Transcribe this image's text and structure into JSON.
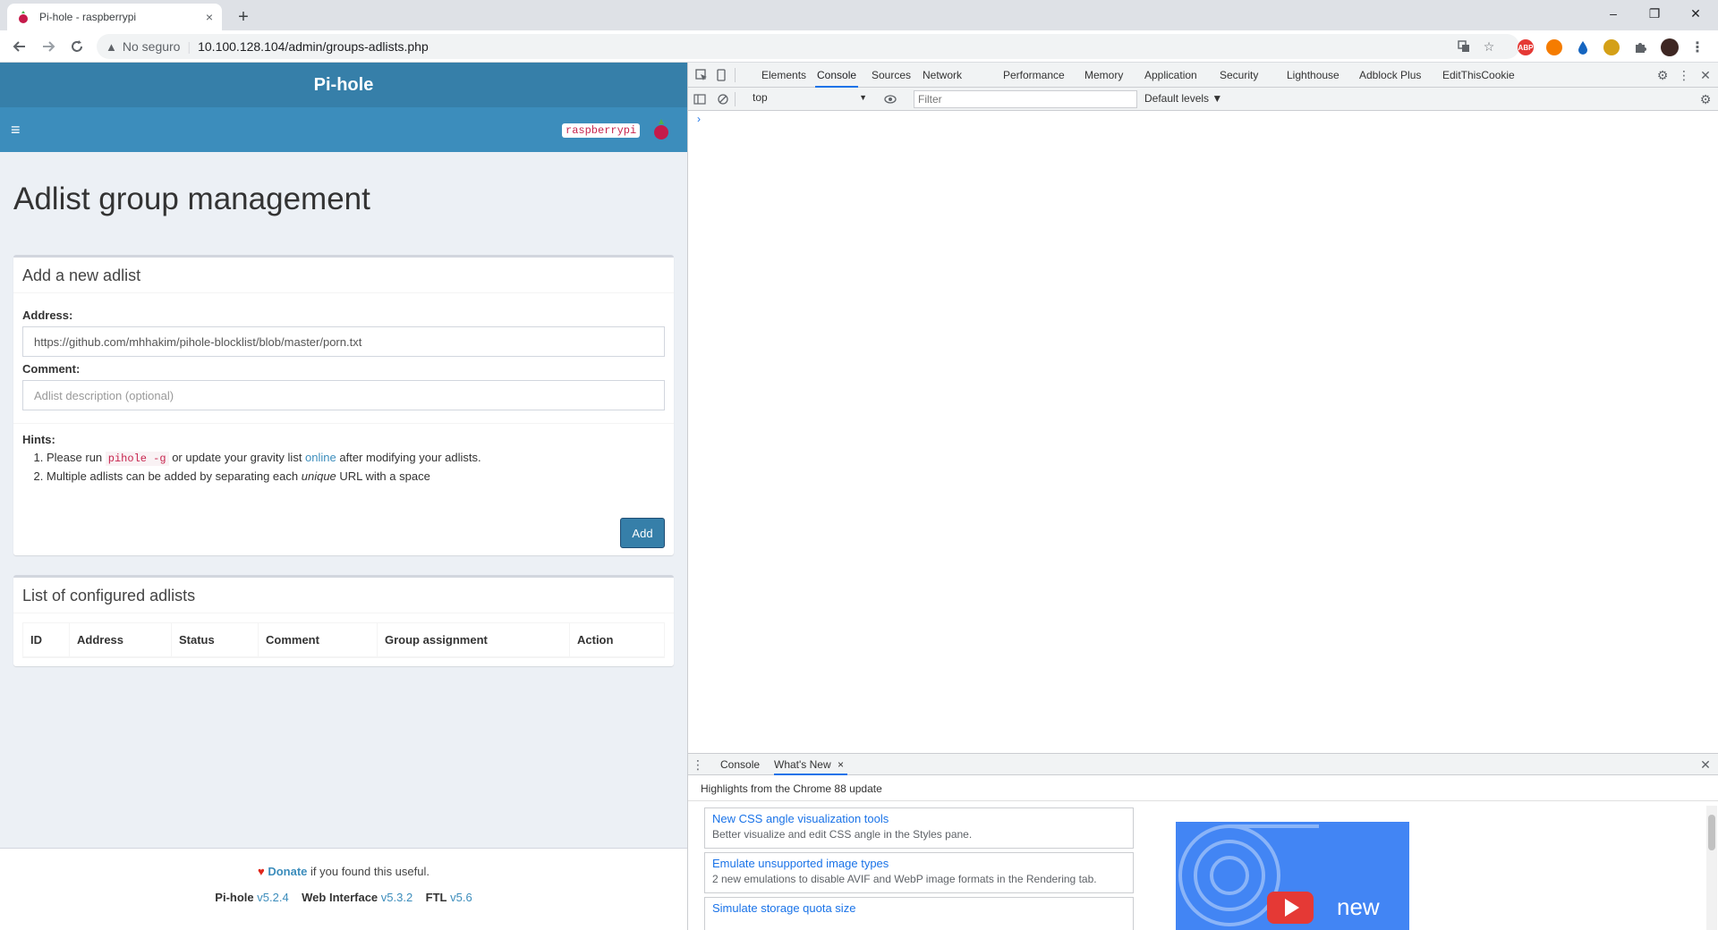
{
  "browser": {
    "tab_title": "Pi-hole - raspberrypi",
    "tab_close": "×",
    "new_tab": "+",
    "security_label": "No seguro",
    "url": "10.100.128.104/admin/groups-adlists.php",
    "window_controls": [
      "–",
      "❐",
      "✕"
    ],
    "extensions": [
      "ABP"
    ]
  },
  "pihole": {
    "brand": "Pi-hole",
    "menu_toggle": "≡",
    "hostname": "raspberrypi",
    "page_title": "Adlist group management",
    "add_box": {
      "title": "Add a new adlist",
      "address_label": "Address:",
      "address_value": "https://github.com/mhhakim/pihole-blocklist/blob/master/porn.txt",
      "comment_label": "Comment:",
      "comment_placeholder": "Adlist description (optional)",
      "hints_label": "Hints:",
      "hint1_pre": "Please run ",
      "hint1_code": "pihole -g",
      "hint1_mid": " or update your gravity list ",
      "hint1_link": "online",
      "hint1_post": " after modifying your adlists.",
      "hint2_pre": "Multiple adlists can be added by separating each ",
      "hint2_em": "unique",
      "hint2_post": " URL with a space",
      "add_button": "Add"
    },
    "list_box": {
      "title": "List of configured adlists",
      "columns": [
        "ID",
        "Address",
        "Status",
        "Comment",
        "Group assignment",
        "Action"
      ]
    },
    "footer": {
      "heart": "♥",
      "donate": "Donate",
      "donate_suffix": " if you found this useful.",
      "pihole_label": "Pi-hole",
      "pihole_version": "v5.2.4",
      "web_label": "Web Interface",
      "web_version": "v5.3.2",
      "ftl_label": "FTL",
      "ftl_version": "v5.6"
    }
  },
  "devtools": {
    "tabs": [
      "Elements",
      "Console",
      "Sources",
      "Network",
      "Performance",
      "Memory",
      "Application",
      "Security",
      "Lighthouse",
      "Adblock Plus",
      "EditThisCookie"
    ],
    "active_tab": "Console",
    "context": "top",
    "context_arrow": "▼",
    "filter_placeholder": "Filter",
    "levels": "Default levels ▼",
    "prompt": "›",
    "drawer_tabs": [
      "Console",
      "What's New"
    ],
    "drawer_tab_close": "×",
    "drawer_close": "✕",
    "whats_new_heading": "Highlights from the Chrome 88 update",
    "cards": [
      {
        "title": "New CSS angle visualization tools",
        "desc": "Better visualize and edit CSS angle in the Styles pane."
      },
      {
        "title": "Emulate unsupported image types",
        "desc": "2 new emulations to disable AVIF and WebP image formats in the Rendering tab."
      },
      {
        "title": "Simulate storage quota size",
        "desc": ""
      }
    ],
    "video_text": "new"
  }
}
